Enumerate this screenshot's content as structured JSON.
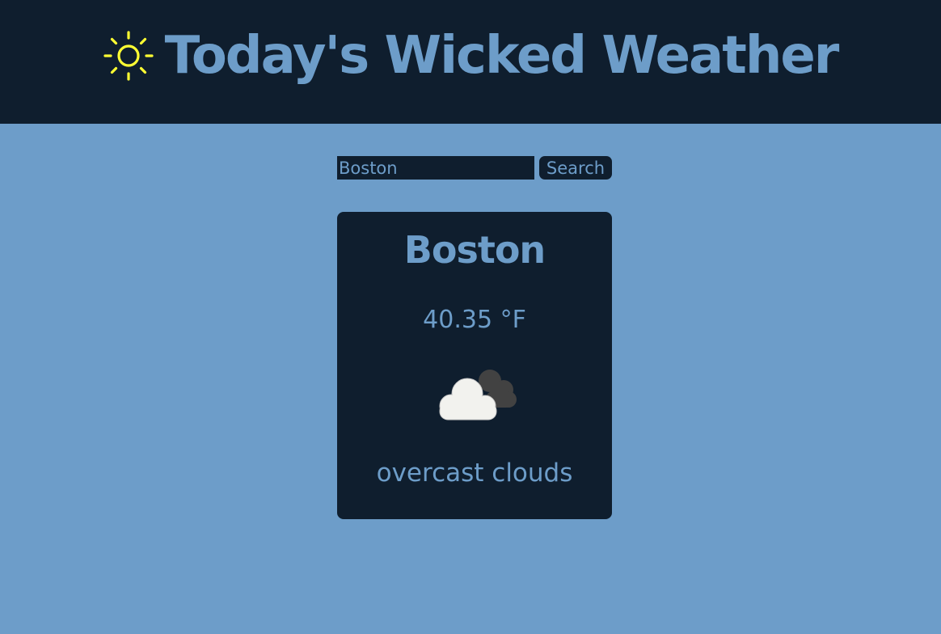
{
  "header": {
    "title": "Today's Wicked Weather",
    "icon": "sun-icon",
    "icon_color": "#ffff33"
  },
  "search": {
    "value": "Boston",
    "button_label": "Search"
  },
  "weather": {
    "city": "Boston",
    "temperature": "40.35",
    "unit": "°F",
    "icon": "overcast-clouds-icon",
    "description": "overcast clouds"
  },
  "colors": {
    "background": "#6d9dc9",
    "panel": "#0f1e2e",
    "accent_text": "#6d9dc9"
  }
}
